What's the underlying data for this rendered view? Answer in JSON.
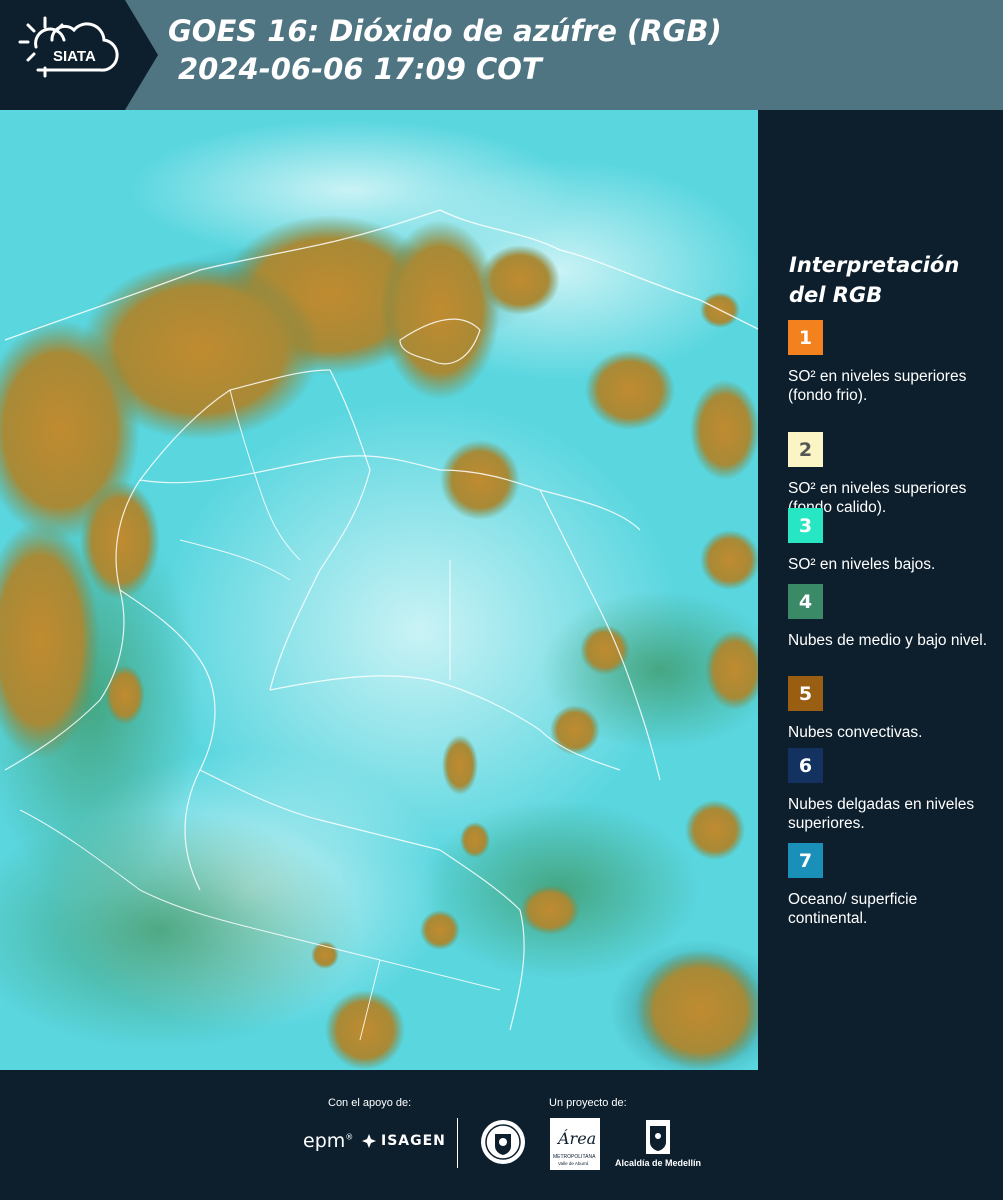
{
  "header": {
    "logo_text": "SIATA",
    "title_line1": "GOES 16: Dióxido de azúfre (RGB)",
    "title_line2": "2024-06-06 17:09 COT"
  },
  "legend": {
    "title": "Interpretación del RGB",
    "items": [
      {
        "number": "1",
        "color": "#f3821e",
        "text_color": "#ffffff",
        "label": "SO² en niveles superiores (fondo frio)."
      },
      {
        "number": "2",
        "color": "#fbf5c5",
        "text_color": "#555555",
        "label": "SO² en niveles superiores (fondo calido)."
      },
      {
        "number": "3",
        "color": "#27e6c4",
        "text_color": "#ffffff",
        "label": "SO² en niveles bajos."
      },
      {
        "number": "4",
        "color": "#3a8a68",
        "text_color": "#ffffff",
        "label": "Nubes de medio y bajo nivel."
      },
      {
        "number": "5",
        "color": "#9a5e13",
        "text_color": "#ffffff",
        "label": "Nubes convectivas."
      },
      {
        "number": "6",
        "color": "#14325f",
        "text_color": "#ffffff",
        "label": "Nubes delgadas en niveles superiores."
      },
      {
        "number": "7",
        "color": "#1a8fb7",
        "text_color": "#ffffff",
        "label": "Oceano/ superficie continental."
      }
    ]
  },
  "footer": {
    "support_caption": "Con el apoyo de:",
    "project_caption": "Un proyecto de:",
    "epm_logo": "epm",
    "isagen_logo": "ISAGEN",
    "area_logo": "Área",
    "area_sub": "METROPOLITANA",
    "area_sub2": "Valle de Aburrá",
    "alcaldia_logo": "Alcaldía de Medellín"
  },
  "map": {
    "base_color": "#5ad6df",
    "cloud_color": "#b5822c",
    "boundary_color": "#ffffff"
  }
}
